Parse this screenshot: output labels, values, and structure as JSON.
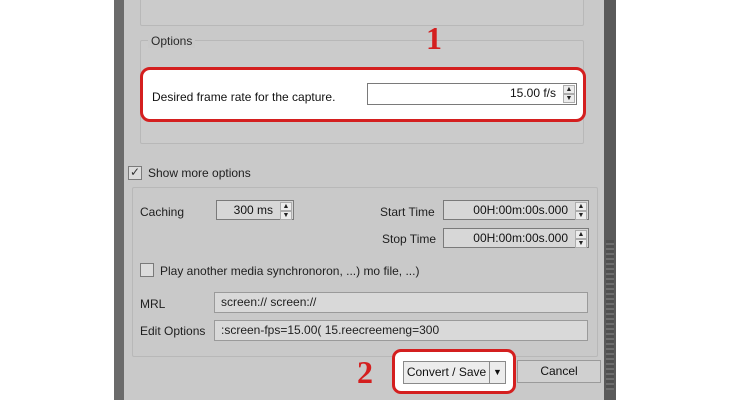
{
  "markers": {
    "one": "1",
    "two": "2"
  },
  "options": {
    "group_title": "Options",
    "framerate_label": "Desired frame rate for the capture.",
    "framerate_value": "15.00 f/s"
  },
  "more": {
    "show_more_label": "Show more options",
    "show_more_checked": true,
    "caching_label": "Caching",
    "caching_value": "300 ms",
    "start_time_label": "Start Time",
    "start_time_value": "00H:00m:00s.000",
    "stop_time_label": "Stop Time",
    "stop_time_value": "00H:00m:00s.000",
    "play_another_label": "Play another media synchronoron, ...)        mo file, ...)",
    "play_another_checked": false,
    "mrl_label": "MRL",
    "mrl_value": "screen://                         screen://",
    "edit_options_label": "Edit Options",
    "edit_options_value": ":screen-fps=15.00( 15.reecreemeng=300"
  },
  "buttons": {
    "convert_save": "Convert / Save",
    "cancel": "Cancel"
  },
  "icons": {
    "spin_up": "up-arrow-icon",
    "spin_down": "down-arrow-icon",
    "dropdown": "caret-down-icon"
  },
  "colors": {
    "highlight": "#d41f1f",
    "dialog_bg": "#c9c9c9"
  }
}
